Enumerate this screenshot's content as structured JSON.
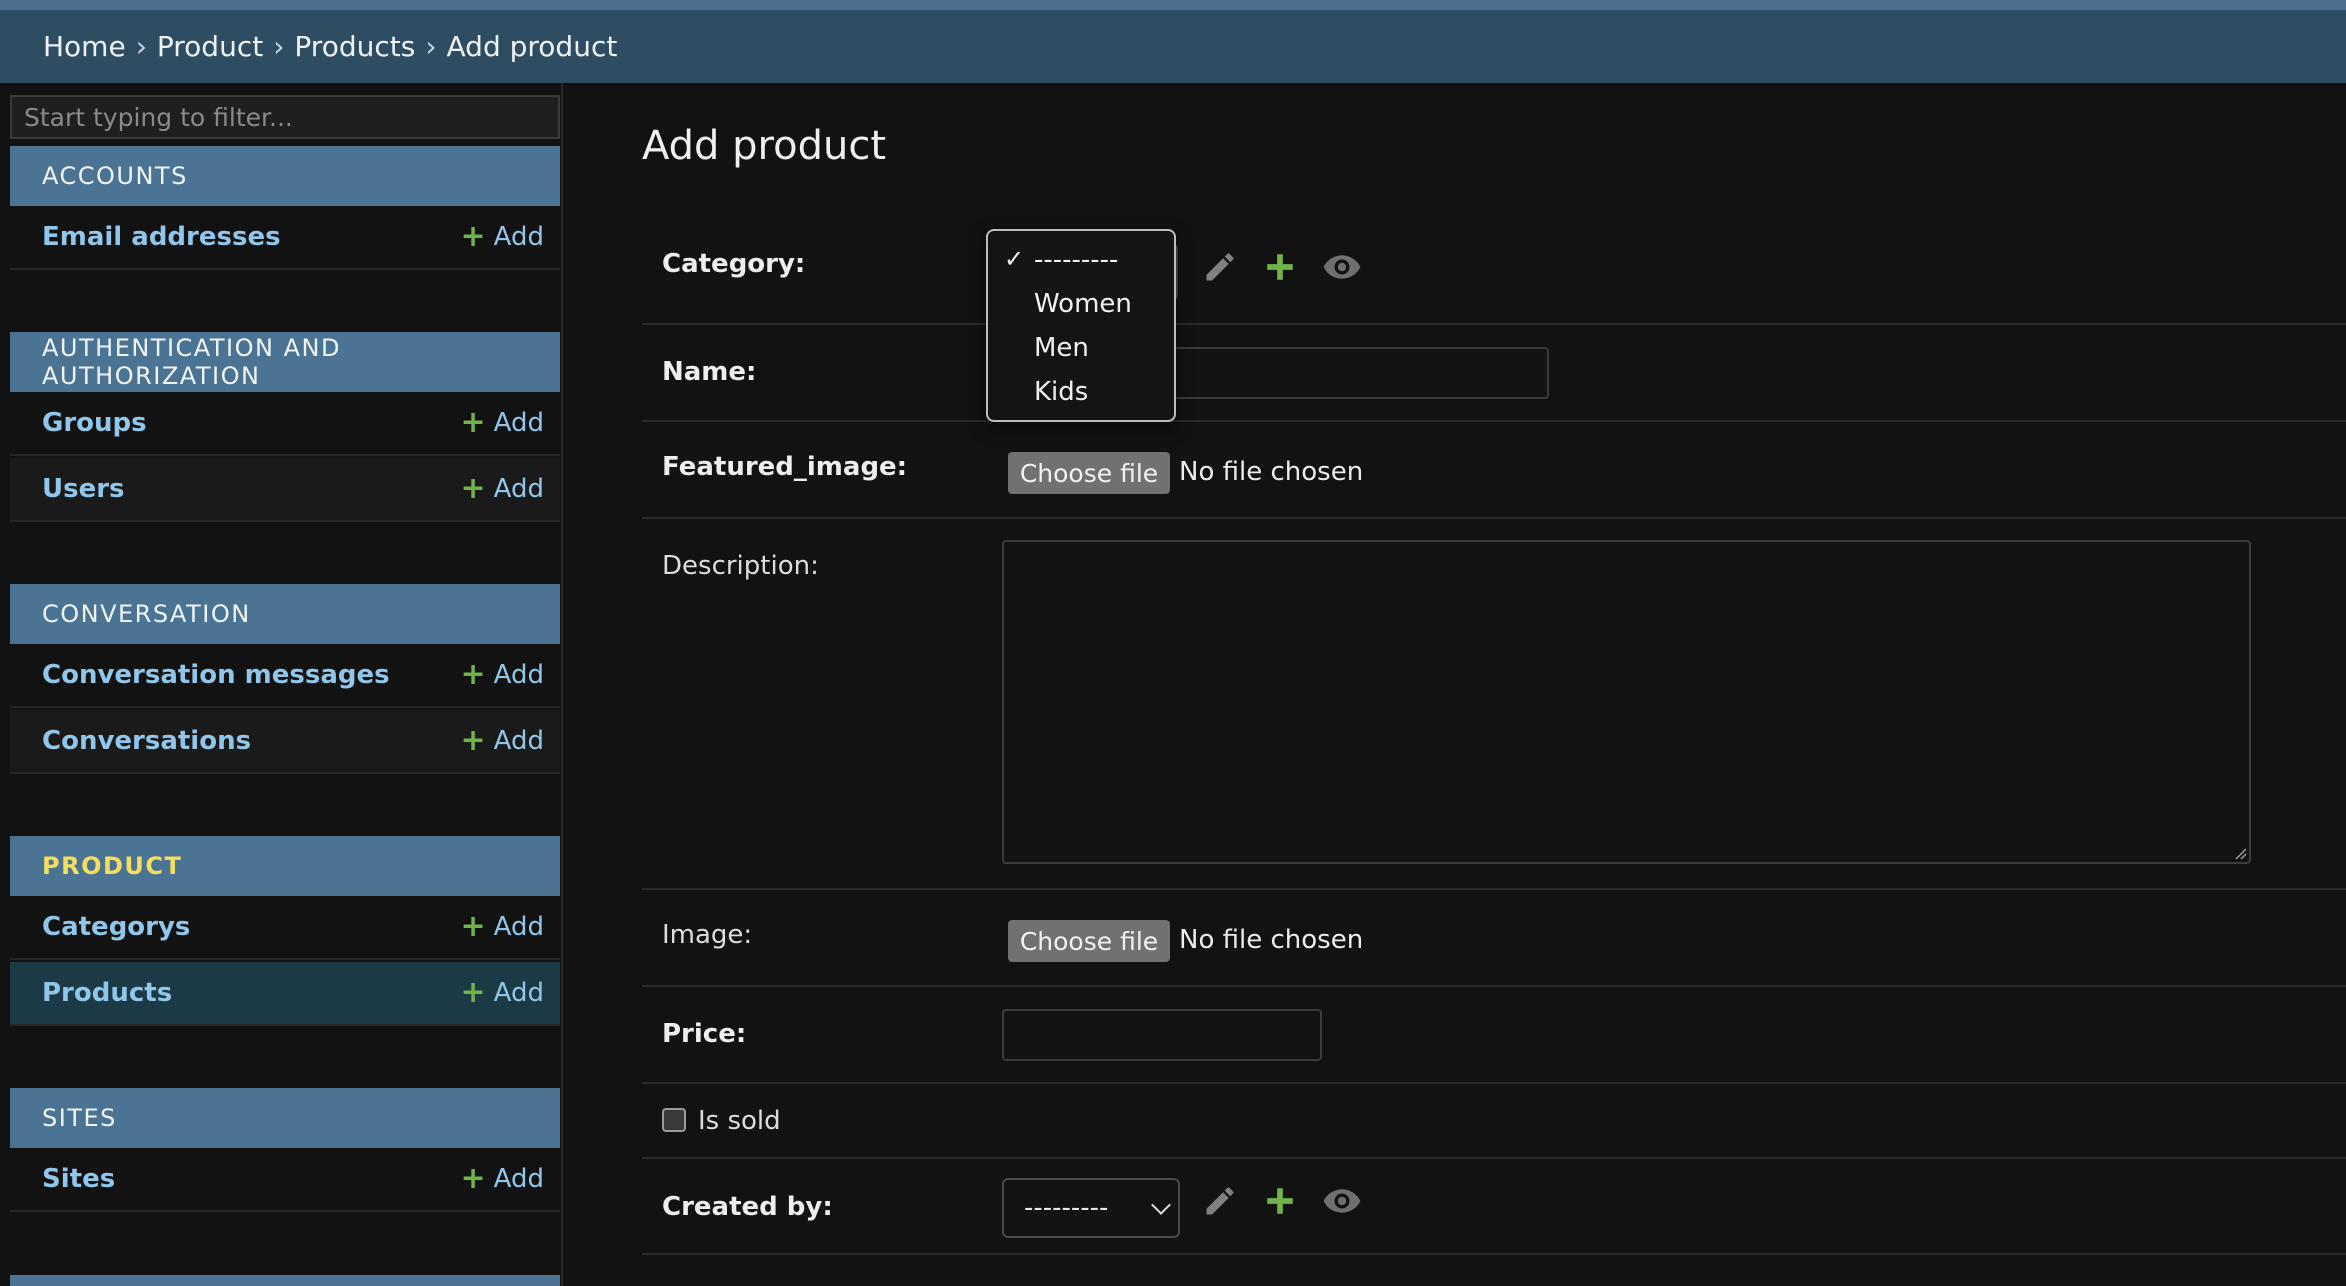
{
  "breadcrumbs": {
    "items": [
      "Home",
      "Product",
      "Products",
      "Add product"
    ],
    "separator": "›"
  },
  "sidebar": {
    "filter_placeholder": "Start typing to filter...",
    "add_label": "Add",
    "apps": [
      {
        "name": "ACCOUNTS",
        "models": [
          "Email addresses"
        ]
      },
      {
        "name": "AUTHENTICATION AND AUTHORIZATION",
        "models": [
          "Groups",
          "Users"
        ]
      },
      {
        "name": "CONVERSATION",
        "models": [
          "Conversation messages",
          "Conversations"
        ]
      },
      {
        "name": "PRODUCT",
        "models": [
          "Categorys",
          "Products"
        ],
        "current": true,
        "selected_model": "Products"
      },
      {
        "name": "SITES",
        "models": [
          "Sites"
        ]
      }
    ]
  },
  "main": {
    "title": "Add product",
    "fields": {
      "category": {
        "label": "Category:",
        "value": "---------"
      },
      "name": {
        "label": "Name:",
        "value": ""
      },
      "featured_image": {
        "label": "Featured_image:",
        "button": "Choose file",
        "status": "No file chosen"
      },
      "description": {
        "label": "Description:",
        "value": ""
      },
      "image": {
        "label": "Image:",
        "button": "Choose file",
        "status": "No file chosen"
      },
      "price": {
        "label": "Price:",
        "value": ""
      },
      "is_sold": {
        "label": "Is sold",
        "checked": false
      },
      "created_by": {
        "label": "Created by:",
        "value": "---------"
      }
    }
  },
  "category_dropdown": {
    "checkmark": "✓",
    "options": [
      "---------",
      "Women",
      "Men",
      "Kids"
    ],
    "selected_index": 0
  },
  "colors": {
    "accent_green": "#70b34a",
    "link_blue": "#8fc6ea",
    "header_blue": "#4b7394",
    "breadcrumb_bg": "#2f4d62",
    "current_app": "#f5dd5d"
  }
}
